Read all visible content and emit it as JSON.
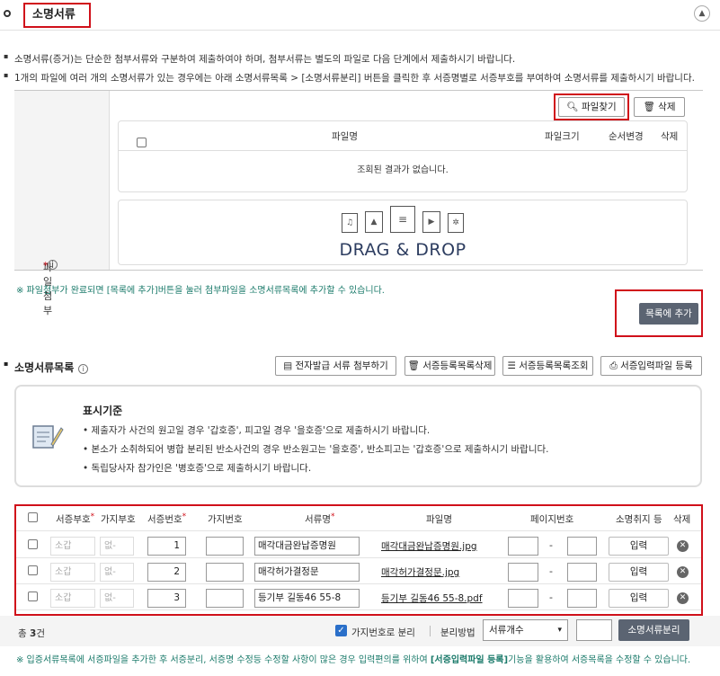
{
  "section": {
    "title": "소명서류",
    "collapse_icon": "chevron-up-icon"
  },
  "notes": [
    "소명서류(증거)는 단순한 첨부서류와 구분하여 제출하여야 하며, 첨부서류는 별도의 파일로 다음 단계에서 제출하시기 바랍니다.",
    "1개의 파일에 여러 개의 소명서류가 있는 경우에는 아래 소명서류목록 > [소명서류분리] 버튼을 클릭한 후 서증명별로 서증부호를 부여하여 소명서류를 제출하시기 바랍니다."
  ],
  "attach": {
    "label": "파일첨부",
    "find_btn": "파일찾기",
    "delete_btn": "삭제",
    "cols": {
      "name": "파일명",
      "size": "파일크기",
      "order": "순서변경",
      "del": "삭제"
    },
    "empty": "조회된 결과가 없습니다.",
    "dnd": "DRAG & DROP"
  },
  "tip": "※ 파일첨부가 완료되면 [목록에 추가]버튼을 눌러 첨부파일을 소명서류목록에 추가할 수 있습니다.",
  "add_btn": "목록에 추가",
  "list": {
    "title": "소명서류목록",
    "btns": [
      "전자발급 서류 첨부하기",
      "서증등록목록삭제",
      "서증등록목록조회",
      "서증입력파일 등록"
    ]
  },
  "standard": {
    "title": "표시기준",
    "lines": [
      "제출자가 사건의 원고일 경우 '갑호증', 피고일 경우 '을호증'으로 제출하시기 바랍니다.",
      "본소가 소취하되어 병합 분리된 반소사건의 경우 반소원고는 '을호증', 반소피고는 '갑호증'으로 제출하시기 바랍니다.",
      "독립당사자 참가인은 '병호증'으로 제출하시기 바랍니다."
    ]
  },
  "table": {
    "headers": {
      "code": "서증부호",
      "branch": "가지부호",
      "num": "서증번호",
      "branchnum": "가지번호",
      "doctype": "서류명",
      "file": "파일명",
      "page": "페이지번호",
      "cancel": "소명취지 등",
      "del": "삭제"
    },
    "rows": [
      {
        "code": "소갑",
        "branch": "없-",
        "num": "1",
        "doc": "매각대금완납증명원",
        "file": "매각대금완납증명원.jpg",
        "action": "입력"
      },
      {
        "code": "소갑",
        "branch": "없-",
        "num": "2",
        "doc": "매각허가결정문",
        "file": "매각허가결정문.jpg",
        "action": "입력"
      },
      {
        "code": "소갑",
        "branch": "없-",
        "num": "3",
        "doc": "등기부 길동46 55-8",
        "file": "등기부 길동46 55-8.pdf",
        "action": "입력"
      }
    ],
    "dash": "-"
  },
  "footer": {
    "total_prefix": "총",
    "total": "3",
    "total_suffix": "건",
    "split_check": "가지번호로 분리",
    "method_label": "분리방법",
    "method_value": "서류개수",
    "split_btn": "소명서류분리"
  },
  "bottom_note_a": "※ 입증서류목록에 서증파일을 추가한 후 서증분리, 서증명 수정등 수정할 사항이 많은 경우 입력편의를 위하여 ",
  "bottom_note_b": "[서증입력파일 등록]",
  "bottom_note_c": "기능을 활용하여 서증목록을 수정할 수 있습니다."
}
